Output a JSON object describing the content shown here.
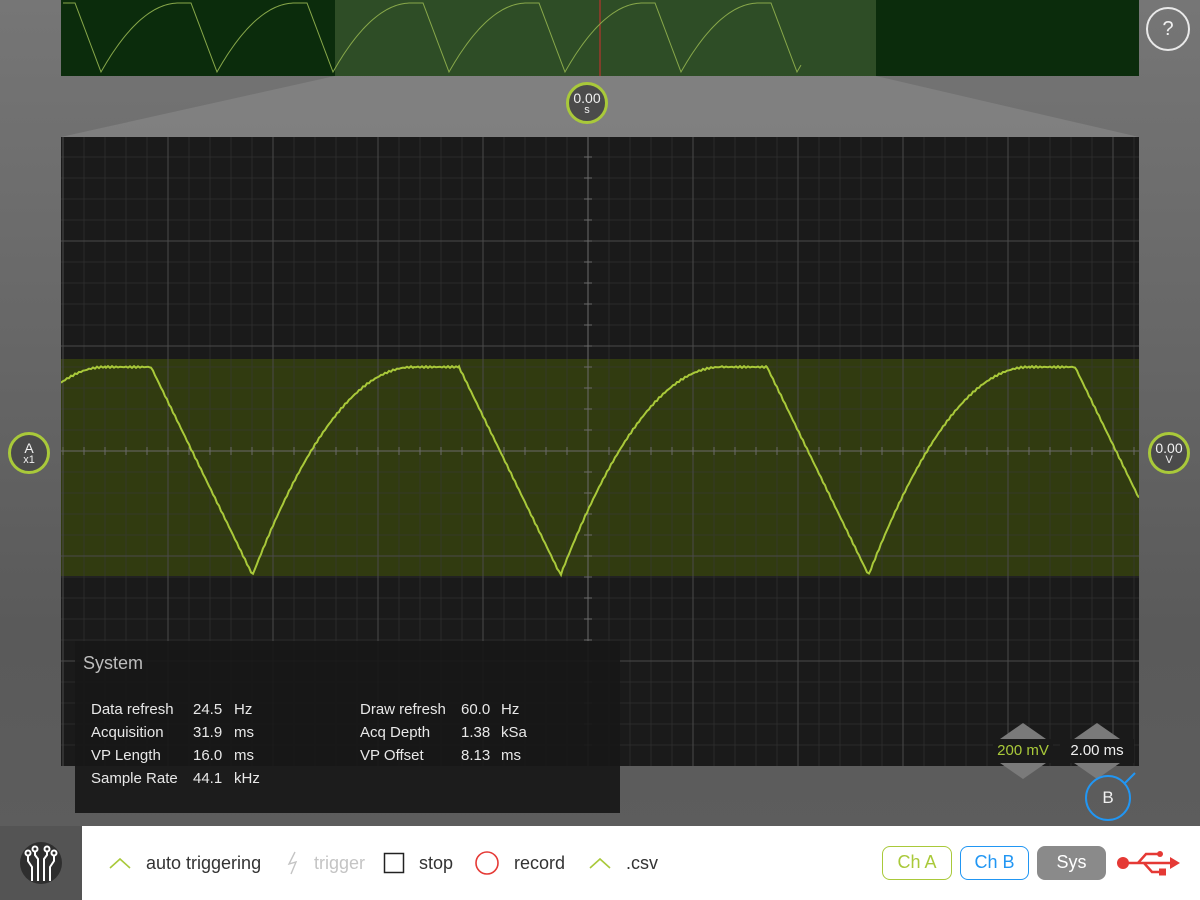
{
  "help": {
    "label": "?"
  },
  "time_marker": {
    "value": "0.00",
    "unit": "s"
  },
  "channel_marker": {
    "name": "A",
    "gain": "x1"
  },
  "offset_marker": {
    "value": "0.00",
    "unit": "V"
  },
  "b_marker": {
    "label": "B"
  },
  "scales": {
    "voltage": "200 mV",
    "time": "2.00 ms"
  },
  "system": {
    "title": "System",
    "stats_left": [
      {
        "label": "Data refresh",
        "value": "24.5",
        "unit": "Hz"
      },
      {
        "label": "Acquisition",
        "value": "31.9",
        "unit": "ms"
      },
      {
        "label": "VP Length",
        "value": "16.0",
        "unit": "ms"
      },
      {
        "label": "Sample Rate",
        "value": "44.1",
        "unit": "kHz"
      }
    ],
    "stats_right": [
      {
        "label": "Draw refresh",
        "value": "60.0",
        "unit": "Hz"
      },
      {
        "label": "Acq Depth",
        "value": "1.38",
        "unit": "kSa"
      },
      {
        "label": "VP Offset",
        "value": "8.13",
        "unit": "ms"
      }
    ]
  },
  "toolbar": {
    "auto_triggering": "auto triggering",
    "trigger": "trigger",
    "stop": "stop",
    "record": "record",
    "csv": ".csv"
  },
  "channels": {
    "a": "Ch A",
    "b": "Ch B",
    "sys": "Sys"
  },
  "colors": {
    "channel_a": "#a9c93a",
    "channel_b": "#2196f3",
    "record": "#e53935",
    "usb": "#e53935"
  },
  "icons": {
    "logo": "circuit-tree-icon",
    "help": "question-icon",
    "auto_triggering": "chevron-up-icon",
    "trigger": "lightning-icon",
    "stop": "checkbox-icon",
    "record": "record-circle-icon",
    "csv": "chevron-up-icon",
    "usb": "usb-icon"
  }
}
